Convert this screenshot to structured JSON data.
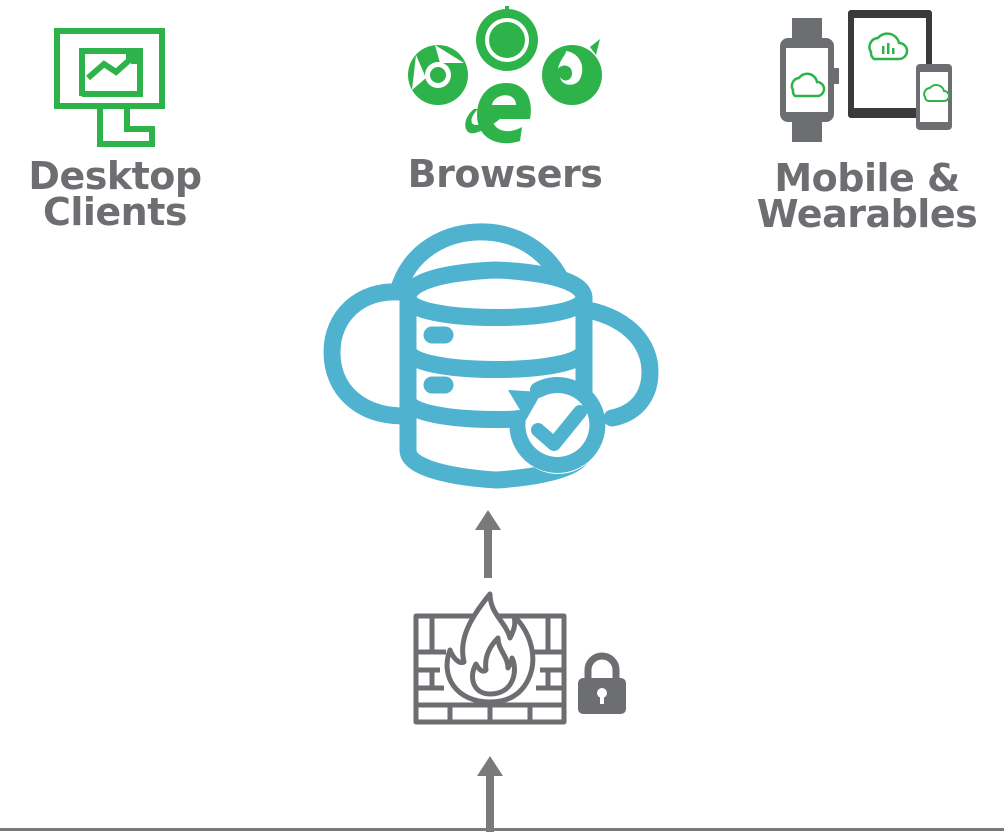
{
  "clients": {
    "desktop": {
      "line1": "Desktop",
      "line2": "Clients",
      "icon": "desktop-monitor-chart-icon"
    },
    "browsers": {
      "label": "Browsers",
      "icon": "browser-logos-icon"
    },
    "mobile": {
      "line1": "Mobile &",
      "line2": "Wearables",
      "icon": "mobile-wearable-devices-icon"
    }
  },
  "center": {
    "icon": "cloud-database-sync-icon"
  },
  "security": {
    "firewall_icon": "firewall-icon",
    "lock_icon": "lock-icon"
  },
  "colors": {
    "green": "#2db34a",
    "cloud_blue": "#4fb3cf",
    "gray": "#6d6e71",
    "arrow_gray": "#7a7a7a"
  }
}
